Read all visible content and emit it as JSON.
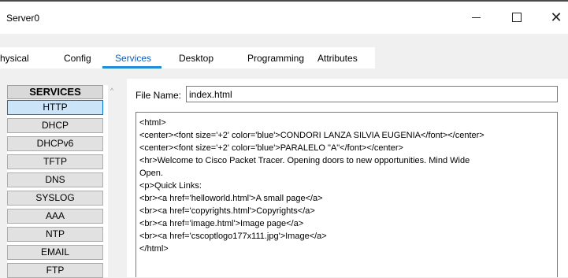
{
  "window": {
    "title": "Server0"
  },
  "controls": {
    "minimize": "–",
    "maximize": "☐",
    "close": "✕"
  },
  "tabs": [
    {
      "label": "hysical"
    },
    {
      "label": "Config"
    },
    {
      "label": "Services"
    },
    {
      "label": "Desktop"
    },
    {
      "label": "Programming"
    },
    {
      "label": "Attributes"
    }
  ],
  "sidebar": {
    "header": "SERVICES",
    "items": [
      {
        "label": "HTTP"
      },
      {
        "label": "DHCP"
      },
      {
        "label": "DHCPv6"
      },
      {
        "label": "TFTP"
      },
      {
        "label": "DNS"
      },
      {
        "label": "SYSLOG"
      },
      {
        "label": "AAA"
      },
      {
        "label": "NTP"
      },
      {
        "label": "EMAIL"
      },
      {
        "label": "FTP"
      }
    ],
    "selected": "HTTP"
  },
  "file": {
    "label": "File Name:",
    "value": "index.html"
  },
  "editor": {
    "lines": [
      "<html>",
      "<center><font size='+2' color='blue'>CONDORI LANZA SILVIA EUGENIA</font></center>",
      "<center><font size='+2' color='blue'>PARALELO \"A\"</font></center>",
      "<hr>Welcome to Cisco Packet Tracer. Opening doors to new opportunities. Mind Wide",
      "Open.",
      "<p>Quick Links:",
      "<br><a href='helloworld.html'>A small page</a>",
      "<br><a href='copyrights.html'>Copyrights</a>",
      "<br><a href='image.html'>Image page</a>",
      "<br><a href='cscoptlogo177x111.jpg'>Image</a>",
      "</html>"
    ]
  },
  "colors": {
    "accent": "#1e8cd6",
    "selected_bg": "#cce4f7"
  }
}
